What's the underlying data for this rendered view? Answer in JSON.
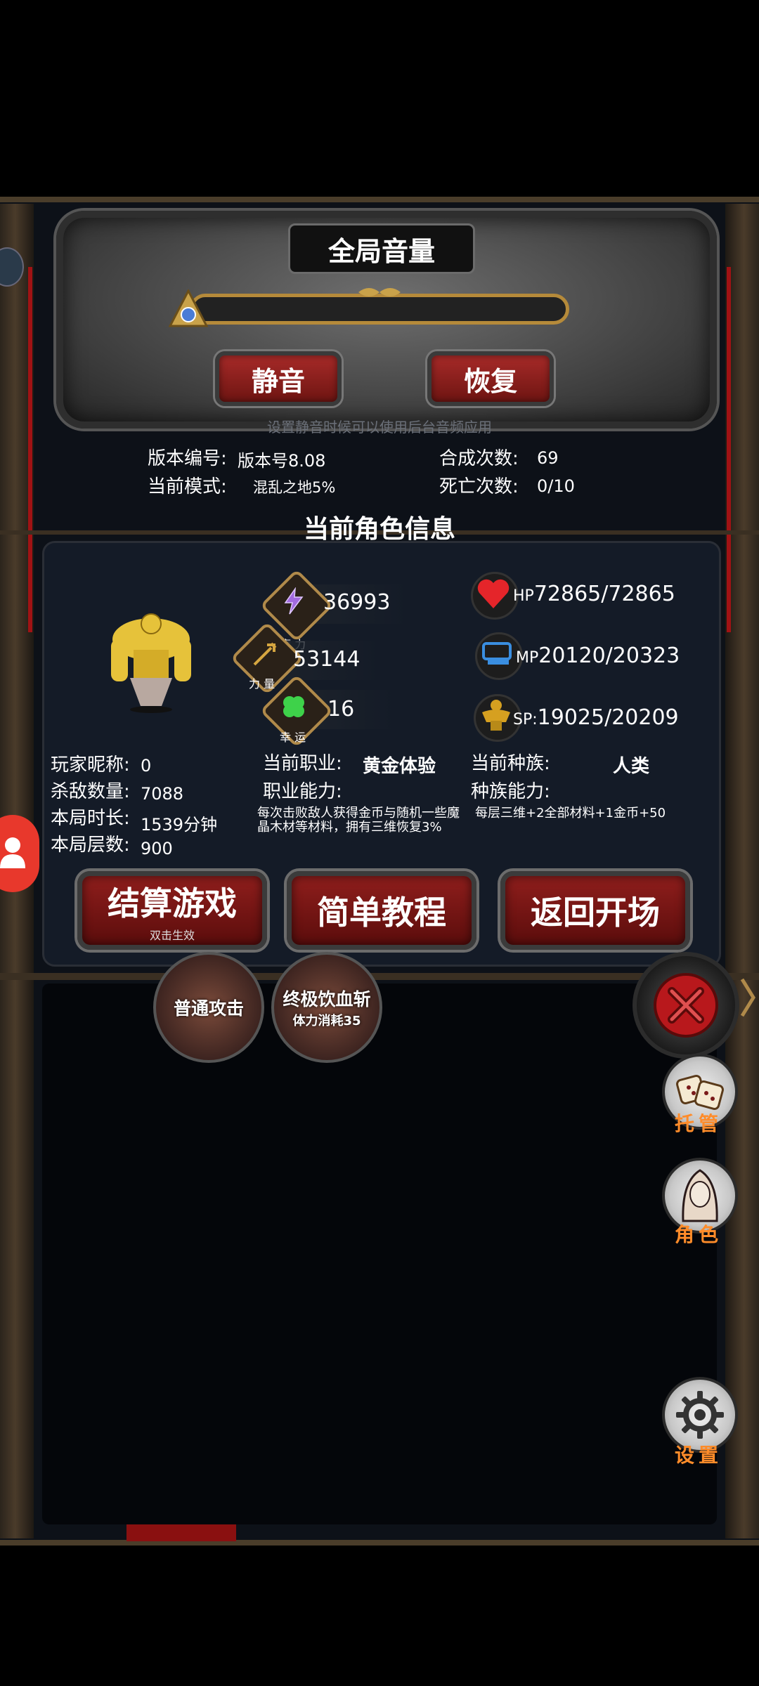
{
  "volume": {
    "title": "全局音量",
    "mute_label": "静音",
    "restore_label": "恢复",
    "hint": "设置静音时候可以使用后台音频应用"
  },
  "game_info": {
    "version_label": "版本编号:",
    "version_value": "版本号8.08",
    "mode_label": "当前模式:",
    "mode_value": "混乱之地5%",
    "craft_label": "合成次数:",
    "craft_value": "69",
    "death_label": "死亡次数:",
    "death_value": "0/10"
  },
  "character": {
    "section_title": "当前角色信息",
    "stats": {
      "magic_label": "魔 力",
      "magic_value": "36993",
      "power_label": "力 量",
      "power_value": "53144",
      "luck_label": "幸 运",
      "luck_value": "16"
    },
    "resources": {
      "hp_prefix": "HP",
      "hp_value": "72865/72865",
      "mp_prefix": "MP",
      "mp_value": "20120/20323",
      "sp_prefix": "SP:",
      "sp_value": "19025/20209"
    },
    "nickname_label": "玩家昵称:",
    "nickname_value": "0",
    "kills_label": "杀敌数量:",
    "kills_value": "7088",
    "duration_label": "本局时长:",
    "duration_value": "1539分钟",
    "floors_label": "本局层数:",
    "floors_value": "900",
    "job_label": "当前职业:",
    "job_value": "黄金体验",
    "job_ability_label": "职业能力:",
    "job_ability_desc": "每次击败敌人获得金币与随机一些魔晶木材等材料，拥有三维恢复3%",
    "race_label": "当前种族:",
    "race_value": "人类",
    "race_ability_label": "种族能力:",
    "race_ability_desc": "每层三维+2全部材料+1金币+50"
  },
  "actions": {
    "settle_label": "结算游戏",
    "settle_sub": "双击生效",
    "tutorial_label": "简单教程",
    "return_label": "返回开场"
  },
  "skills": {
    "normal_attack": "普通攻击",
    "ultimate": "终极饮血斩",
    "ultimate_cost": "体力消耗35"
  },
  "side_menu": {
    "auto_label": "托管",
    "character_label": "角色",
    "settings_label": "设置"
  },
  "colors": {
    "accent_red": "#a72a28",
    "side_label": "#ff8c2a",
    "gold_frame": "#b58a3a"
  },
  "icons": {
    "magic": "lightning-icon",
    "power": "trident-icon",
    "luck": "clover-icon",
    "hp": "heart-icon",
    "mp": "boots-icon",
    "sp": "muscle-icon",
    "close": "close-icon",
    "dice": "dice-icon",
    "hood": "hooded-figure-icon",
    "gear": "gear-icon"
  }
}
